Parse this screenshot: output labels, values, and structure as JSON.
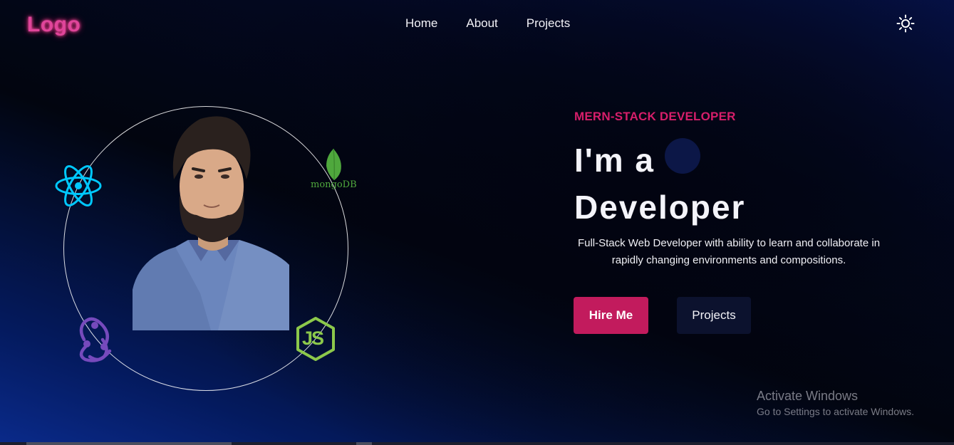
{
  "header": {
    "logo": "Logo",
    "nav": [
      "Home",
      "About",
      "Projects"
    ],
    "theme_icon": "sun-icon"
  },
  "hero": {
    "tagline": "MERN-STACK DEVELOPER",
    "title_line1": "I'm a",
    "title_line2": "Developer",
    "description": "Full-Stack Web Developer with ability to learn and collaborate in rapidly changing environments and compositions.",
    "buttons": {
      "primary": "Hire Me",
      "secondary": "Projects"
    }
  },
  "tech_icons": {
    "react": "react-icon",
    "mongodb": "mongodb-icon",
    "mongodb_label": "mongoDB",
    "redux": "redux-icon",
    "node": "nodejs-icon",
    "node_label": "JS"
  },
  "watermark": {
    "title": "Activate Windows",
    "subtitle": "Go to Settings to activate Windows."
  },
  "colors": {
    "accent": "#c21b5d",
    "tagline": "#d61e6a",
    "logo": "#e0459a",
    "react": "#00c8ff",
    "mongodb": "#4fa83d",
    "redux": "#764abc",
    "node": "#8cc84b"
  }
}
